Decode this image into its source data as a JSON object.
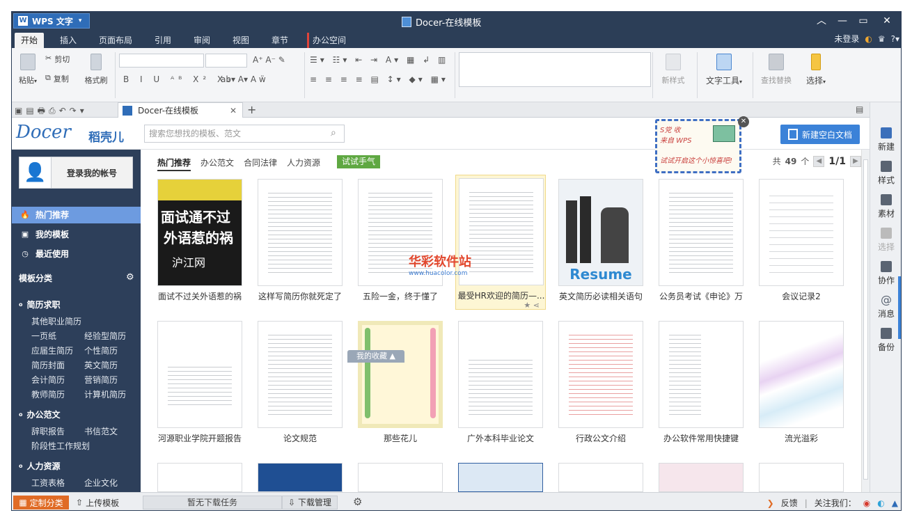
{
  "app": {
    "menu_button": "WPS 文字",
    "title": "Docer-在线模板"
  },
  "menubar": {
    "tabs": [
      "开始",
      "插入",
      "页面布局",
      "引用",
      "审阅",
      "视图",
      "章节",
      "办公空间"
    ],
    "login": "未登录"
  },
  "ribbon": {
    "paste": "粘贴",
    "cut": "剪切",
    "copy": "复制",
    "format_painter": "格式刷",
    "new_style": "新样式",
    "text_tools": "文字工具",
    "find_replace": "查找替换",
    "select": "选择"
  },
  "tabbar": {
    "doc_tab": "Docer-在线模板"
  },
  "sidepanel": {
    "items": [
      "新建",
      "样式",
      "素材",
      "选择",
      "协作",
      "消息",
      "备份"
    ]
  },
  "header": {
    "logo": "Docer",
    "logo_cn": "稻壳儿",
    "search_placeholder": "搜索您想找的模板、范文",
    "new_blank": "新建空白文档",
    "popup_text1": "S党 收",
    "popup_text2": "来自 WPS",
    "popup_text3": "试试开启这个小惊喜吧!"
  },
  "sidebar": {
    "login": "登录我的帐号",
    "nav": [
      "热门推荐",
      "我的模板",
      "最近使用"
    ],
    "category_title": "模板分类",
    "groups": [
      {
        "title": "简历求职",
        "items": [
          "其他职业简历",
          "一页纸",
          "经验型简历",
          "应届生简历",
          "个性简历",
          "简历封面",
          "英文简历",
          "会计简历",
          "营销简历",
          "教师简历",
          "计算机简历"
        ]
      },
      {
        "title": "办公范文",
        "items": [
          "辞职报告",
          "书信范文",
          "阶段性工作规划"
        ]
      },
      {
        "title": "人力资源",
        "items": [
          "工资表格",
          "企业文化"
        ]
      }
    ]
  },
  "main": {
    "tabs": [
      "热门推荐",
      "办公范文",
      "合同法律",
      "人力资源"
    ],
    "try_button": "试试手气",
    "total_label": "共",
    "total_count": "49",
    "total_unit": "个",
    "page": "1/1",
    "row1": [
      "面试不过关外语惹的祸",
      "这样写简历你就死定了",
      "五险一金，终于懂了",
      "最受HR欢迎的简历—...",
      "英文简历必读相关语句",
      "公务员考试《申论》万",
      "会议记录2"
    ],
    "row2": [
      "河源职业学院开题报告",
      "论文规范",
      "那些花儿",
      "广外本科毕业论文",
      "行政公文介绍",
      "办公软件常用快捷键",
      "流光溢彩"
    ],
    "thumb1_text1": "面试通不过",
    "thumb1_text2": "外语惹的祸",
    "thumb1_brand": "沪江网",
    "thumb5_text": "Resume",
    "fav_bar": "我的收藏 ▲",
    "watermark": "华彩软件站",
    "watermark_url": "www.huacolor.com"
  },
  "bottombar": {
    "custom_category": "定制分类",
    "upload": "上传模板",
    "download_status": "暂无下载任务",
    "download_manage": "下载管理",
    "feedback": "反馈",
    "follow": "关注我们："
  }
}
